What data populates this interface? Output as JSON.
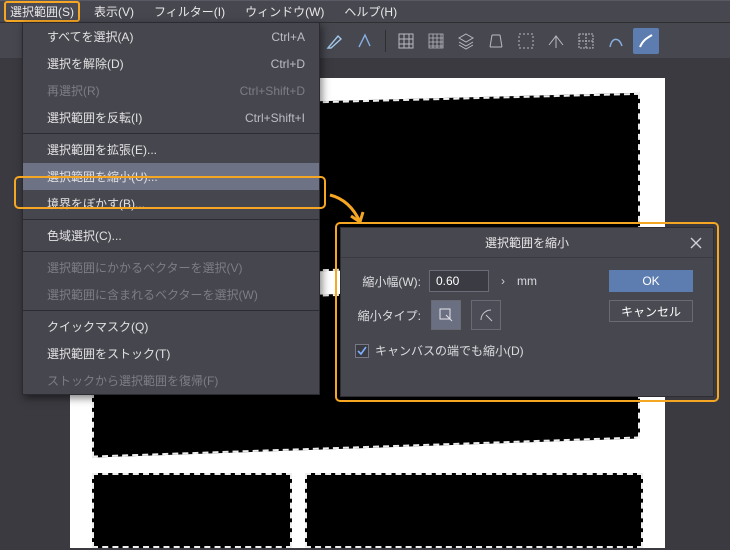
{
  "menubar": {
    "items": [
      {
        "label": "選択範囲(S)",
        "active": true
      },
      {
        "label": "表示(V)"
      },
      {
        "label": "フィルター(I)"
      },
      {
        "label": "ウィンドウ(W)"
      },
      {
        "label": "ヘルプ(H)"
      }
    ]
  },
  "dropdown": {
    "items": [
      {
        "label": "すべてを選択(A)",
        "shortcut": "Ctrl+A"
      },
      {
        "label": "選択を解除(D)",
        "shortcut": "Ctrl+D"
      },
      {
        "label": "再選択(R)",
        "shortcut": "Ctrl+Shift+D",
        "disabled": true
      },
      {
        "label": "選択範囲を反転(I)",
        "shortcut": "Ctrl+Shift+I"
      },
      {
        "sep": true
      },
      {
        "label": "選択範囲を拡張(E)..."
      },
      {
        "label": "選択範囲を縮小(U)...",
        "highlight": true
      },
      {
        "label": "境界をぼかす(B)..."
      },
      {
        "sep": true
      },
      {
        "label": "色域選択(C)..."
      },
      {
        "sep": true
      },
      {
        "label": "選択範囲にかかるベクターを選択(V)",
        "disabled": true
      },
      {
        "label": "選択範囲に含まれるベクターを選択(W)",
        "disabled": true
      },
      {
        "sep": true
      },
      {
        "label": "クイックマスク(Q)"
      },
      {
        "label": "選択範囲をストック(T)"
      },
      {
        "label": "ストックから選択範囲を復帰(F)",
        "disabled": true
      }
    ]
  },
  "dialog": {
    "title": "選択範囲を縮小",
    "width_label": "縮小幅(W):",
    "width_value": "0.60",
    "unit": "mm",
    "type_label": "縮小タイプ:",
    "ok": "OK",
    "cancel": "キャンセル",
    "canvas_edge": "キャンバスの端でも縮小(D)"
  }
}
